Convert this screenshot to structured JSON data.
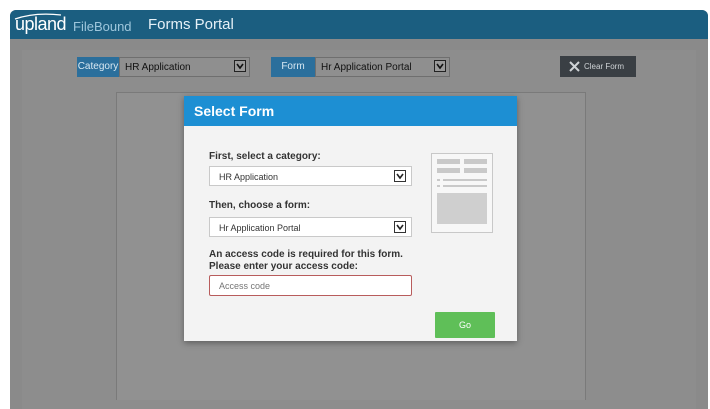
{
  "header": {
    "logo_upland": "upland",
    "logo_filebound": "FileBound",
    "title": "Forms Portal",
    "color": "#1b5e80"
  },
  "toolbar": {
    "category_label": "Category",
    "category_value": "HR Application",
    "form_label": "Form",
    "form_value": "Hr Application Portal",
    "clear_form_label": "Clear Form"
  },
  "modal": {
    "title": "Select Form",
    "header_color": "#1d8fd3",
    "category_prompt": "First, select a category:",
    "category_value": "HR Application",
    "form_prompt": "Then, choose a form:",
    "form_value": "Hr Application Portal",
    "access_prompt_line1": "An access code is required for this form.",
    "access_prompt_line2": "Please enter your access code:",
    "access_placeholder": "Access code",
    "go_label": "Go",
    "go_color": "#5fbf58",
    "form_preview_icon": "form-document-icon"
  },
  "icons": {
    "caret": "chevron-down-icon",
    "clear": "close-icon"
  }
}
